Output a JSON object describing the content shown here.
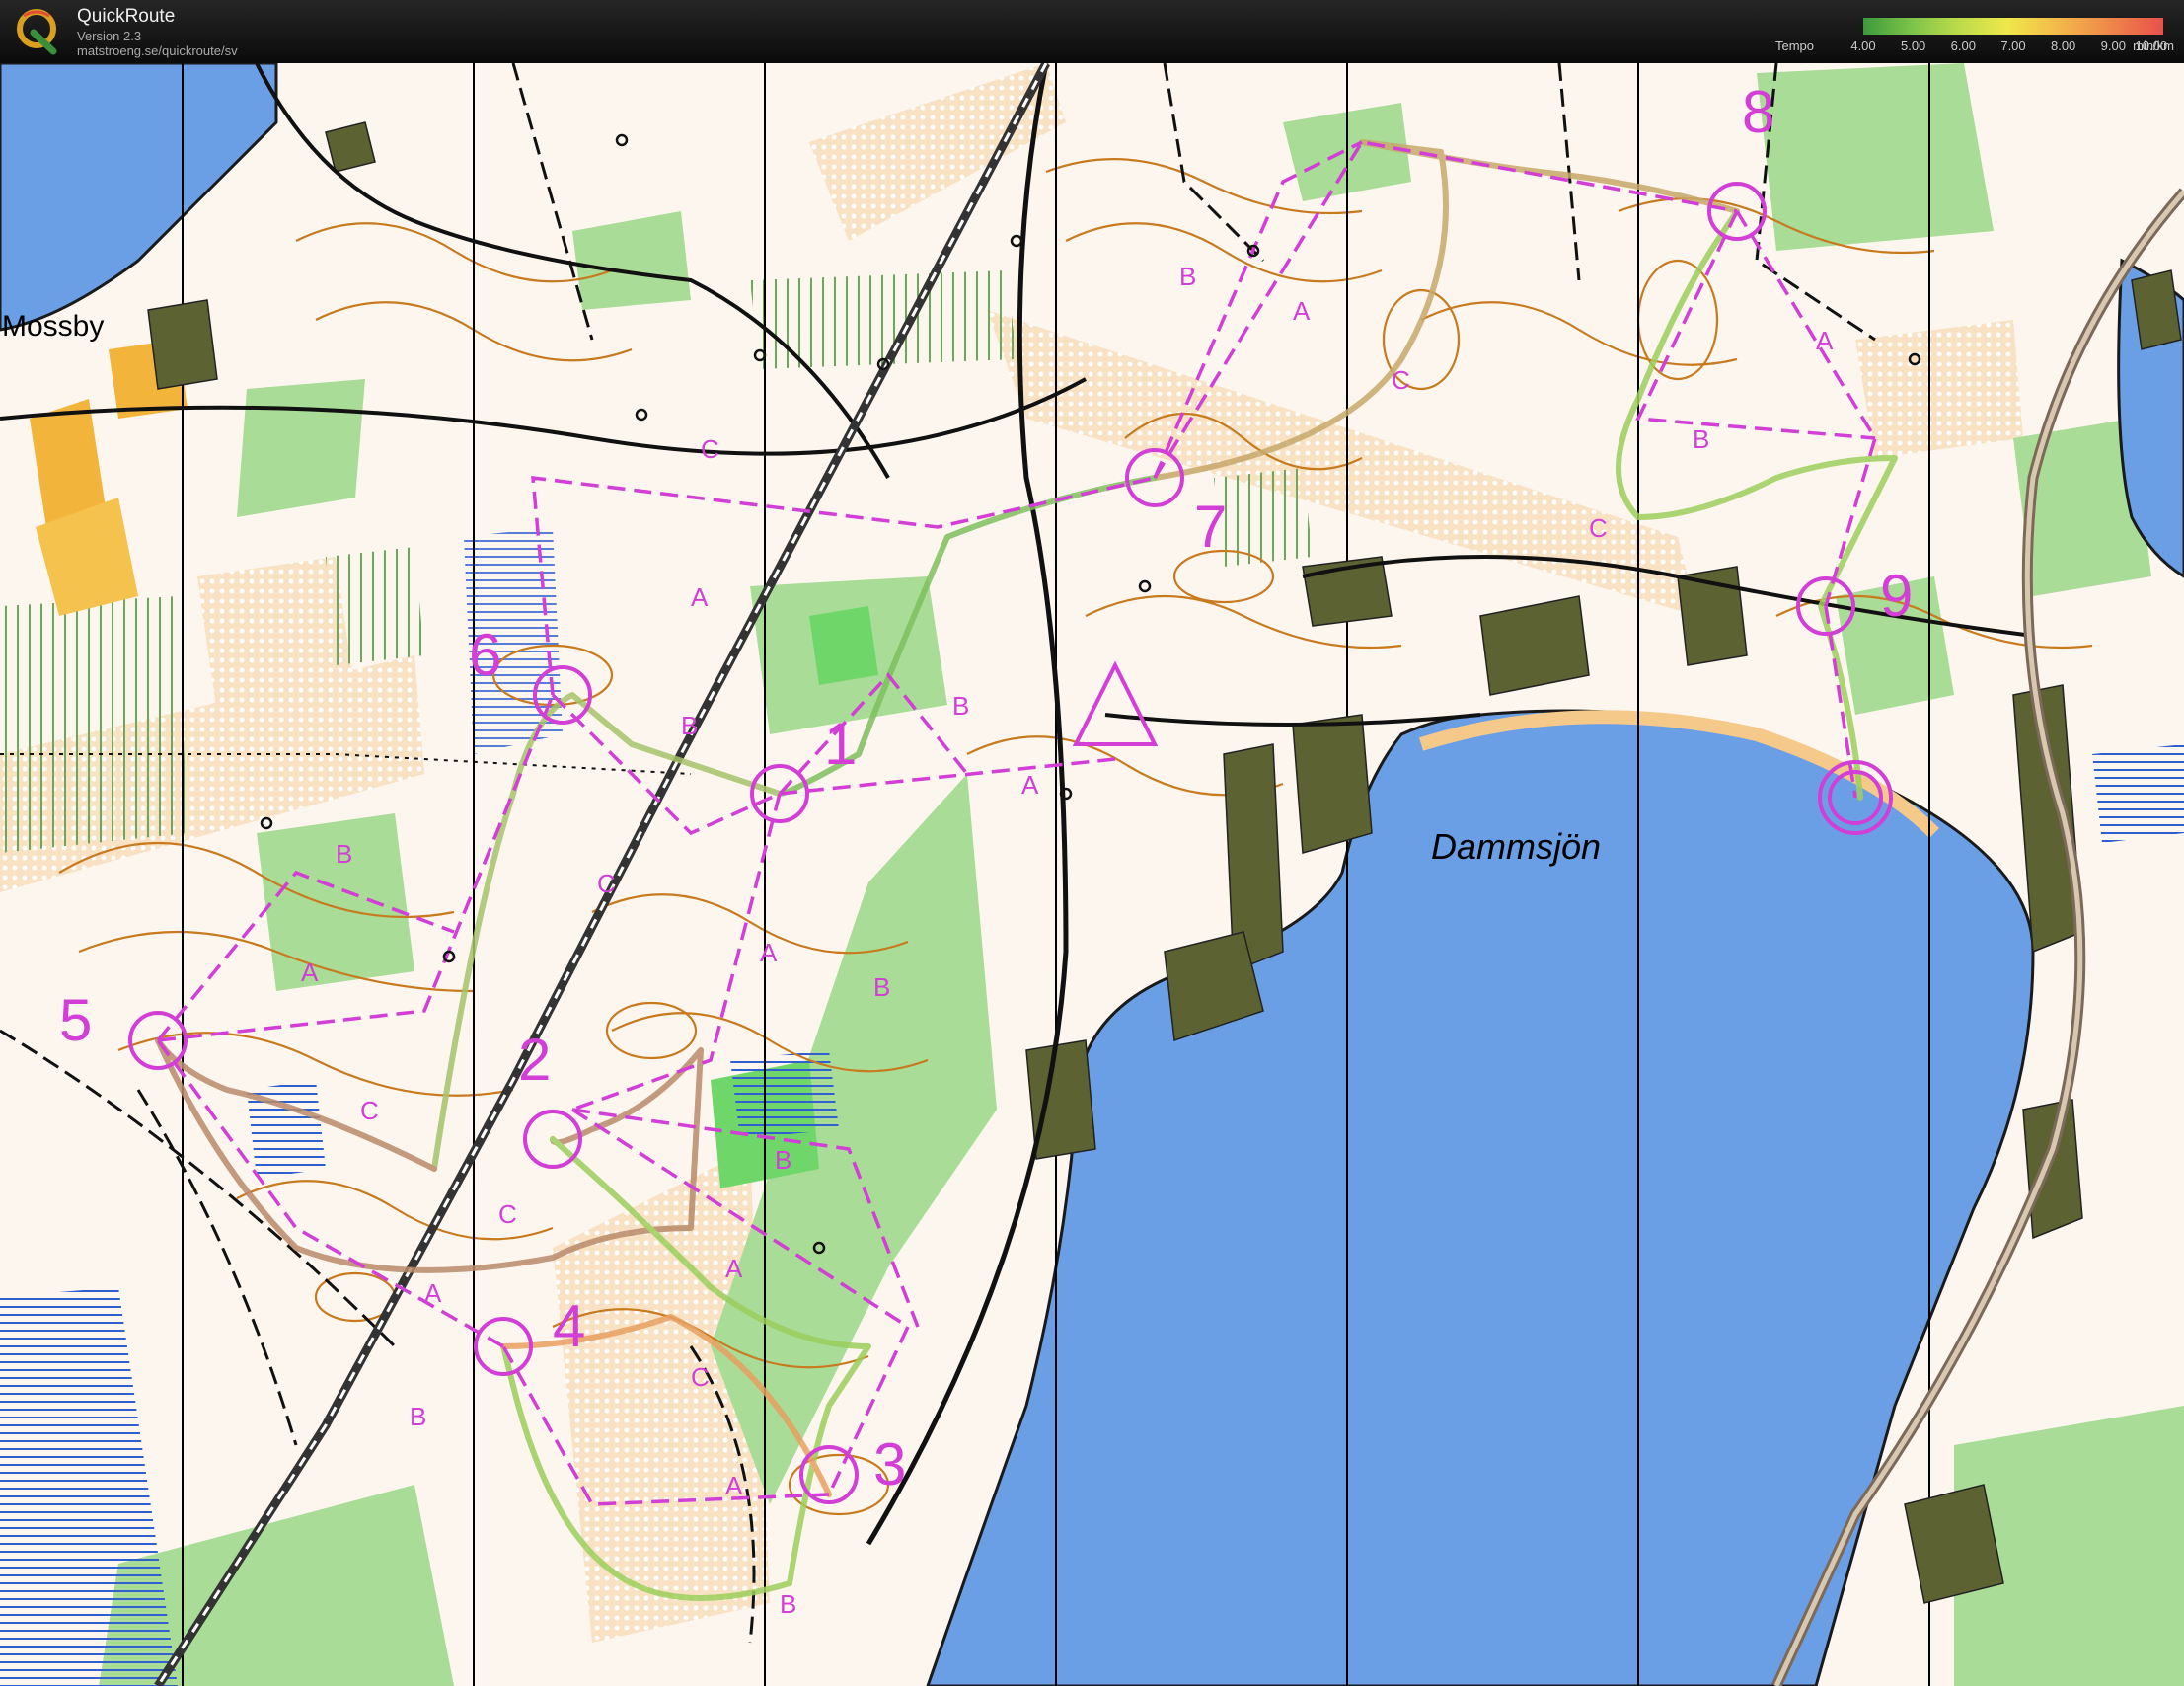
{
  "header": {
    "app_name": "QuickRoute",
    "version": "Version 2.3",
    "url": "matstroeng.se/quickroute/sv",
    "logo_letter": "Q"
  },
  "tempo_legend": {
    "label": "Tempo",
    "ticks": [
      "4.00",
      "5.00",
      "6.00",
      "7.00",
      "8.00",
      "9.00",
      "10.00"
    ],
    "unit": "min/km",
    "colors": [
      "#3c9a3c",
      "#7cc34a",
      "#b5d94a",
      "#eee84a",
      "#f2c14a",
      "#f0944a",
      "#e8504a"
    ]
  },
  "map": {
    "lake_name": "Dammsjön",
    "place_name": "Mossby",
    "course_color": "#d23ed6",
    "water_color": "#6a9fe6",
    "controls": [
      "1",
      "2",
      "3",
      "4",
      "5",
      "6",
      "7",
      "8",
      "9"
    ],
    "leg_letters": [
      "A",
      "B",
      "C"
    ]
  }
}
